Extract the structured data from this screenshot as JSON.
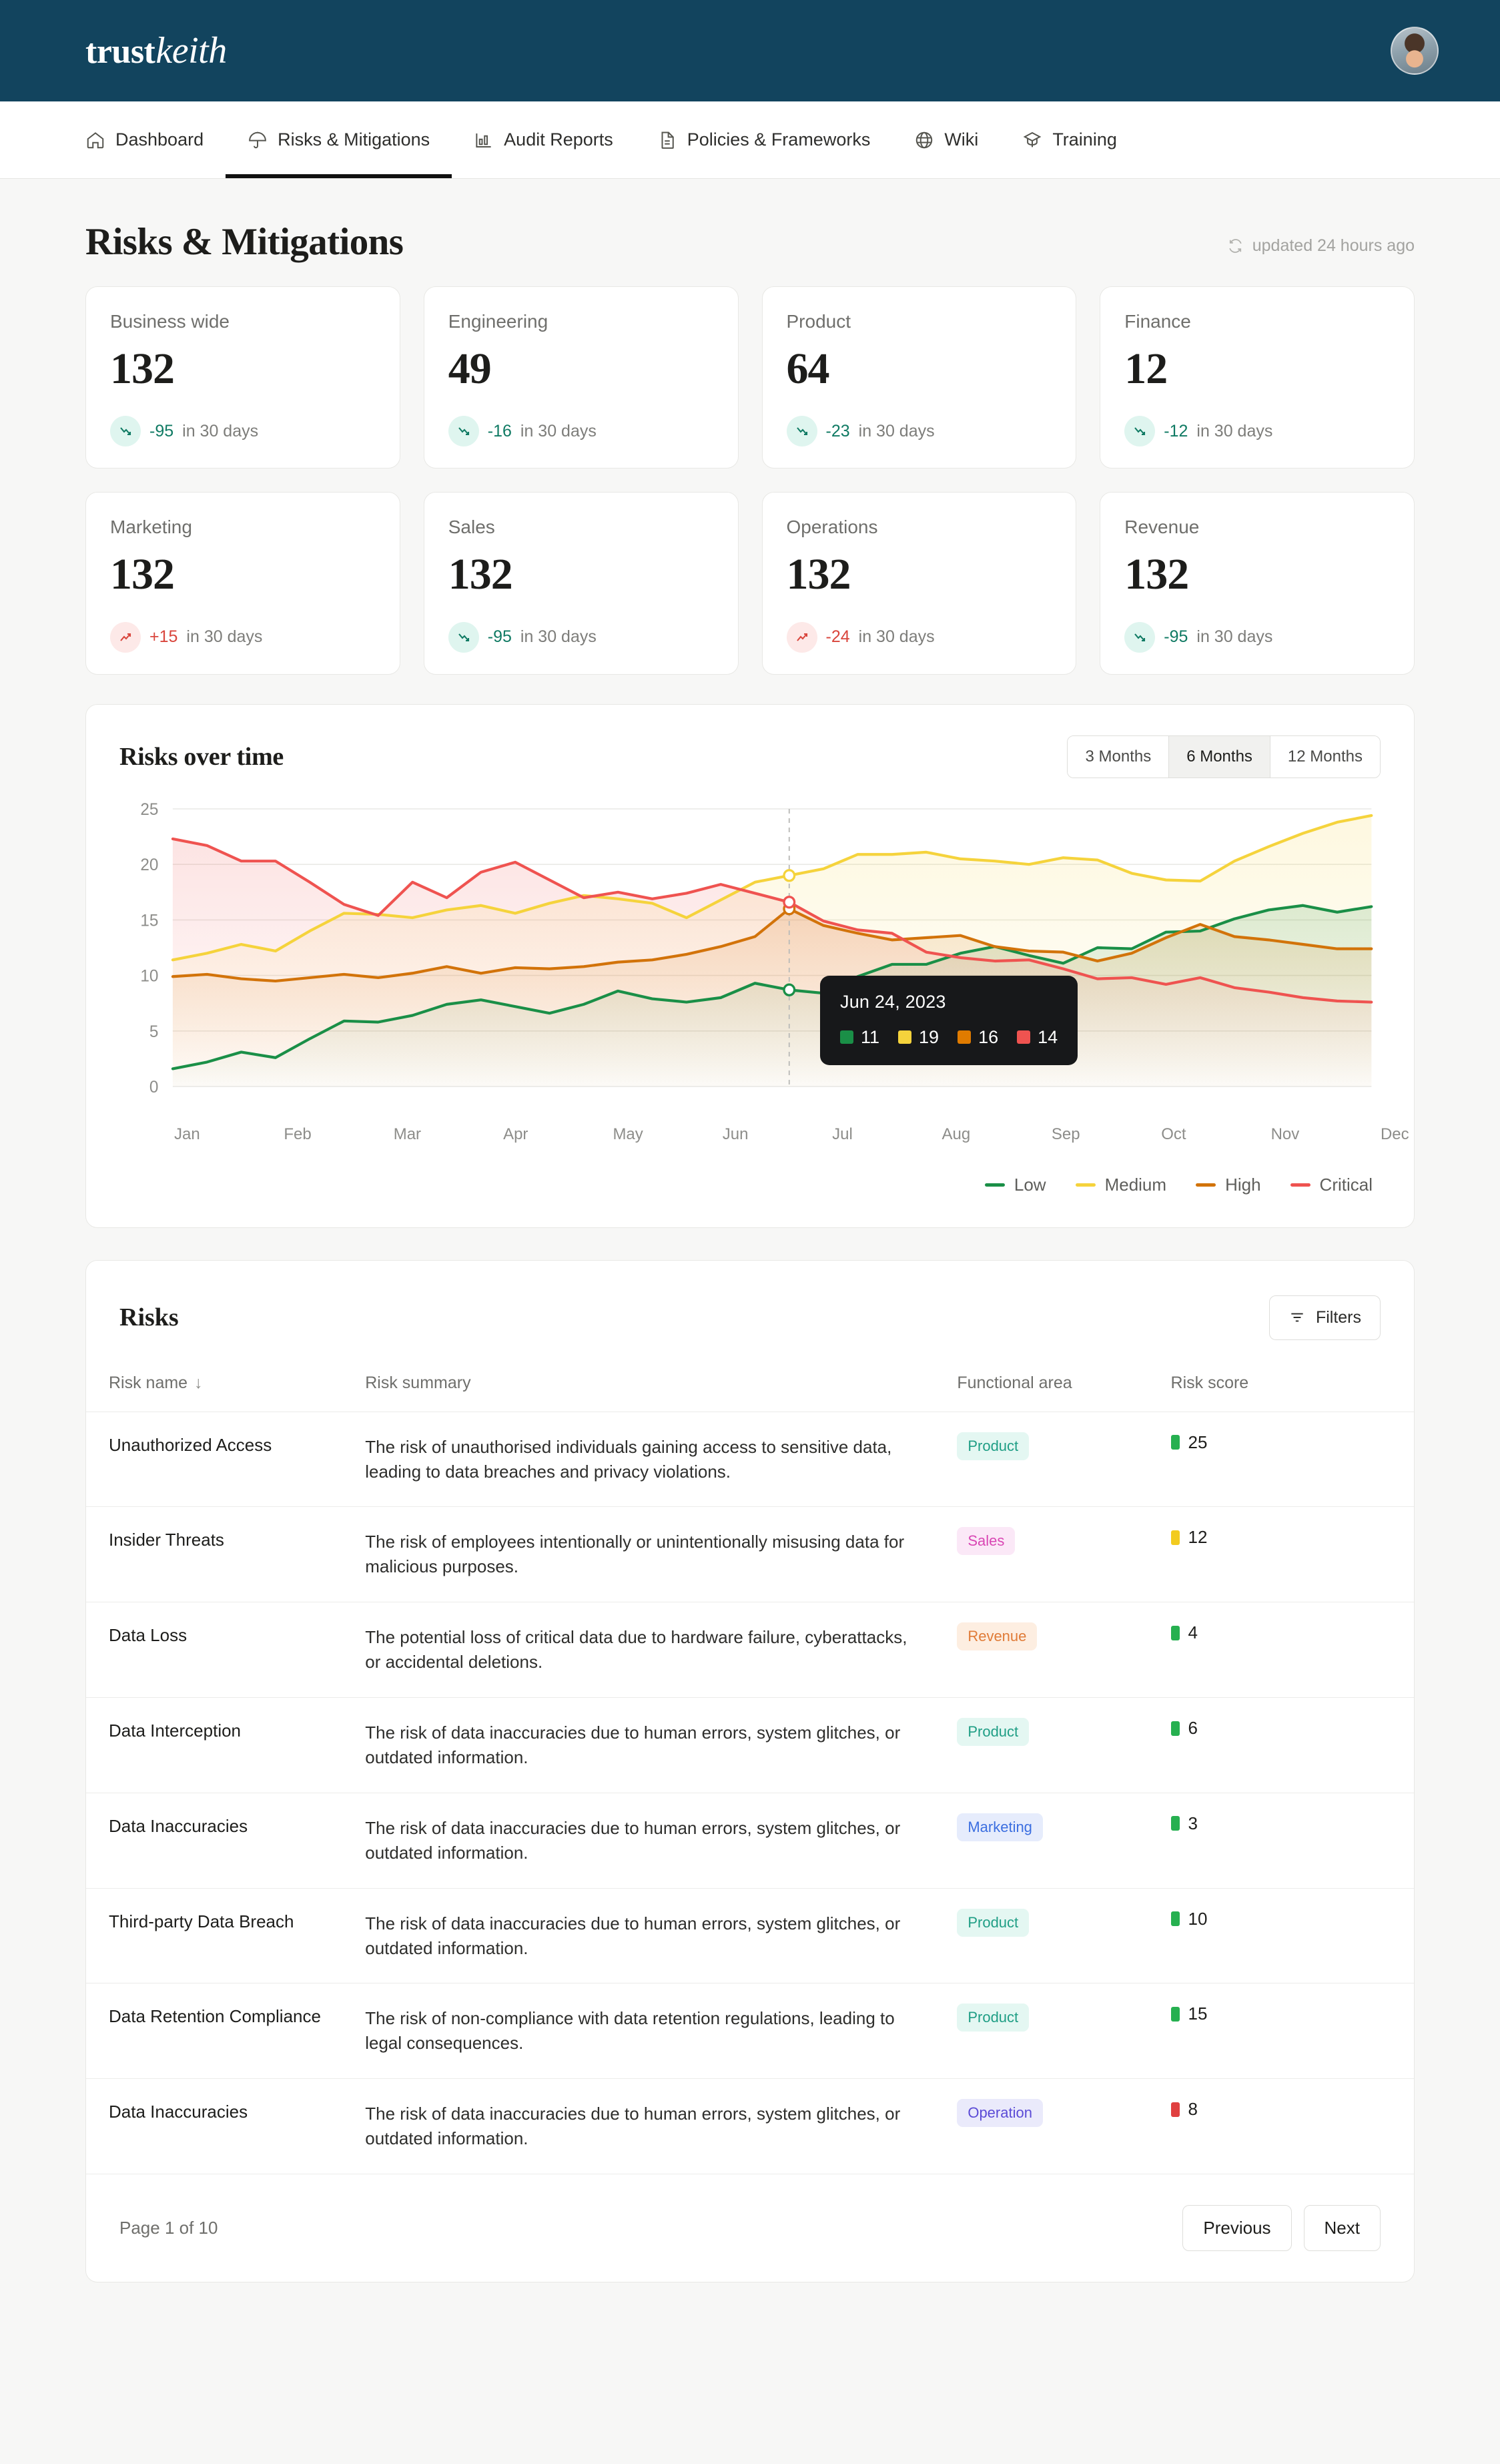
{
  "brand": {
    "part1": "trust",
    "part2": "keith"
  },
  "nav": {
    "items": [
      {
        "label": "Dashboard",
        "icon": "home-icon",
        "active": false
      },
      {
        "label": "Risks & Mitigations",
        "icon": "umbrella-icon",
        "active": true
      },
      {
        "label": "Audit Reports",
        "icon": "bar-chart-icon",
        "active": false
      },
      {
        "label": "Policies & Frameworks",
        "icon": "document-icon",
        "active": false
      },
      {
        "label": "Wiki",
        "icon": "wiki-icon",
        "active": false
      },
      {
        "label": "Training",
        "icon": "graduation-cap-icon",
        "active": false
      }
    ]
  },
  "page": {
    "title": "Risks & Mitigations",
    "updated": "updated 24 hours ago"
  },
  "metrics": [
    {
      "label": "Business wide",
      "value": "132",
      "delta": "-95",
      "suffix": "in 30 days",
      "direction": "down"
    },
    {
      "label": "Engineering",
      "value": "49",
      "delta": "-16",
      "suffix": "in 30 days",
      "direction": "down"
    },
    {
      "label": "Product",
      "value": "64",
      "delta": "-23",
      "suffix": "in 30 days",
      "direction": "down"
    },
    {
      "label": "Finance",
      "value": "12",
      "delta": "-12",
      "suffix": "in 30 days",
      "direction": "down"
    },
    {
      "label": "Marketing",
      "value": "132",
      "delta": "+15",
      "suffix": "in 30 days",
      "direction": "up"
    },
    {
      "label": "Sales",
      "value": "132",
      "delta": "-95",
      "suffix": "in 30 days",
      "direction": "down"
    },
    {
      "label": "Operations",
      "value": "132",
      "delta": "-24",
      "suffix": "in 30 days",
      "direction": "up"
    },
    {
      "label": "Revenue",
      "value": "132",
      "delta": "-95",
      "suffix": "in 30 days",
      "direction": "down"
    }
  ],
  "chart_panel": {
    "title": "Risks over time",
    "ranges": [
      {
        "label": "3 Months",
        "active": false
      },
      {
        "label": "6 Months",
        "active": true
      },
      {
        "label": "12 Months",
        "active": false
      }
    ],
    "tooltip": {
      "date": "Jun 24, 2023",
      "entries": [
        {
          "color": "#1a8f47",
          "value": "11"
        },
        {
          "color": "#f5d33c",
          "value": "19"
        },
        {
          "color": "#e07b00",
          "value": "16"
        },
        {
          "color": "#ef5350",
          "value": "14"
        }
      ]
    }
  },
  "chart_data": {
    "type": "line",
    "title": "Risks over time",
    "xlabel": "",
    "ylabel": "",
    "ylim": [
      0,
      25
    ],
    "yticks": [
      0,
      5,
      10,
      15,
      20,
      25
    ],
    "grid": true,
    "legend_position": "bottom-right",
    "categories": [
      "Jan",
      "Feb",
      "Mar",
      "Apr",
      "May",
      "Jun",
      "Jul",
      "Aug",
      "Sep",
      "Oct",
      "Nov",
      "Dec"
    ],
    "x": [
      "Jan",
      "Jan",
      "Jan",
      "Feb",
      "Feb",
      "Feb",
      "Mar",
      "Mar",
      "Mar",
      "Apr",
      "Apr",
      "Apr",
      "May",
      "May",
      "May",
      "Jun",
      "Jun",
      "Jun",
      "Jul",
      "Jul",
      "Jul",
      "Aug",
      "Aug",
      "Aug",
      "Sep",
      "Sep",
      "Sep",
      "Oct",
      "Oct",
      "Oct",
      "Nov",
      "Nov",
      "Nov",
      "Dec",
      "Dec",
      "Dec"
    ],
    "series": [
      {
        "name": "Low",
        "color": "#1a8f47",
        "values": [
          1.6,
          2.2,
          3.1,
          2.6,
          4.3,
          5.9,
          5.8,
          6.4,
          7.4,
          7.8,
          7.2,
          6.6,
          7.4,
          8.6,
          7.9,
          7.6,
          8.0,
          9.3,
          8.7,
          8.4,
          9.9,
          11.0,
          11.0,
          12.0,
          12.6,
          11.8,
          11.1,
          12.5,
          12.4,
          13.9,
          14.0,
          15.1,
          15.9,
          16.3,
          15.7,
          16.2
        ]
      },
      {
        "name": "Medium",
        "color": "#f5d33c",
        "values": [
          11.4,
          12.0,
          12.8,
          12.2,
          14.0,
          15.6,
          15.5,
          15.2,
          15.9,
          16.3,
          15.6,
          16.5,
          17.2,
          16.9,
          16.5,
          15.2,
          16.8,
          18.4,
          19.0,
          19.6,
          20.9,
          20.9,
          21.1,
          20.5,
          20.3,
          20.0,
          20.6,
          20.4,
          19.2,
          18.6,
          18.5,
          20.3,
          21.6,
          22.8,
          23.8,
          24.4
        ]
      },
      {
        "name": "High",
        "color": "#d2730a",
        "values": [
          9.9,
          10.1,
          9.7,
          9.5,
          9.8,
          10.1,
          9.8,
          10.2,
          10.8,
          10.2,
          10.7,
          10.6,
          10.8,
          11.2,
          11.4,
          11.9,
          12.6,
          13.5,
          16.0,
          14.5,
          13.8,
          13.2,
          13.4,
          13.6,
          12.6,
          12.2,
          12.1,
          11.3,
          12.0,
          13.4,
          14.6,
          13.5,
          13.2,
          12.8,
          12.4,
          12.4
        ]
      },
      {
        "name": "Critical",
        "color": "#ef5350",
        "values": [
          22.3,
          21.7,
          20.3,
          20.3,
          18.4,
          16.4,
          15.4,
          18.4,
          17.0,
          19.3,
          20.2,
          18.6,
          17.0,
          17.5,
          16.9,
          17.4,
          18.2,
          17.4,
          16.6,
          14.9,
          14.1,
          13.8,
          12.1,
          11.6,
          11.3,
          11.4,
          10.6,
          9.7,
          9.8,
          9.2,
          9.8,
          8.9,
          8.5,
          8.0,
          7.7,
          7.6
        ]
      }
    ],
    "annotation": {
      "x": "Jun 24, 2023",
      "values": [
        11,
        19,
        16,
        14
      ]
    }
  },
  "risks_table": {
    "title": "Risks",
    "filters_label": "Filters",
    "columns": [
      "Risk name",
      "Risk summary",
      "Functional area",
      "Risk score",
      ""
    ],
    "sort_icon": "↓",
    "rows": [
      {
        "name": "Unauthorized Access",
        "summary": "The risk of unauthorised individuals gaining access to sensitive data, leading to data breaches and privacy violations.",
        "area": "Product",
        "area_fg": "#1f9e85",
        "area_bg": "#e4f7f2",
        "score": "25",
        "score_color": "#26b050"
      },
      {
        "name": "Insider Threats",
        "summary": "The risk of employees intentionally or unintentionally misusing data for malicious purposes.",
        "area": "Sales",
        "area_fg": "#d946b4",
        "area_bg": "#fbe8f7",
        "score": "12",
        "score_color": "#f2cb20"
      },
      {
        "name": "Data Loss",
        "summary": "The potential loss of critical data due to hardware failure, cyberattacks, or accidental deletions.",
        "area": "Revenue",
        "area_fg": "#e07b37",
        "area_bg": "#fdeee1",
        "score": "4",
        "score_color": "#26b050"
      },
      {
        "name": "Data Interception",
        "summary": "The risk of data inaccuracies due to human errors, system glitches, or outdated information.",
        "area": "Product",
        "area_fg": "#1f9e85",
        "area_bg": "#e4f7f2",
        "score": "6",
        "score_color": "#26b050"
      },
      {
        "name": "Data Inaccuracies",
        "summary": "The risk of data inaccuracies due to human errors, system glitches, or outdated information.",
        "area": "Marketing",
        "area_fg": "#3b6ee0",
        "area_bg": "#e6ecfc",
        "score": "3",
        "score_color": "#26b050"
      },
      {
        "name": "Third-party Data Breach",
        "summary": "The risk of data inaccuracies due to human errors, system glitches, or outdated information.",
        "area": "Product",
        "area_fg": "#1f9e85",
        "area_bg": "#e4f7f2",
        "score": "10",
        "score_color": "#26b050"
      },
      {
        "name": "Data Retention Compliance",
        "summary": "The risk of non-compliance with data retention regulations, leading to legal consequences.",
        "area": "Product",
        "area_fg": "#1f9e85",
        "area_bg": "#e4f7f2",
        "score": "15",
        "score_color": "#26b050"
      },
      {
        "name": "Data Inaccuracies",
        "summary": "The risk of data inaccuracies due to human errors, system glitches, or outdated information.",
        "area": "Operation",
        "area_fg": "#5b4bd6",
        "area_bg": "#eaeafb",
        "score": "8",
        "score_color": "#e04040"
      }
    ],
    "pager": {
      "info": "Page 1 of 10",
      "previous": "Previous",
      "next": "Next"
    }
  }
}
